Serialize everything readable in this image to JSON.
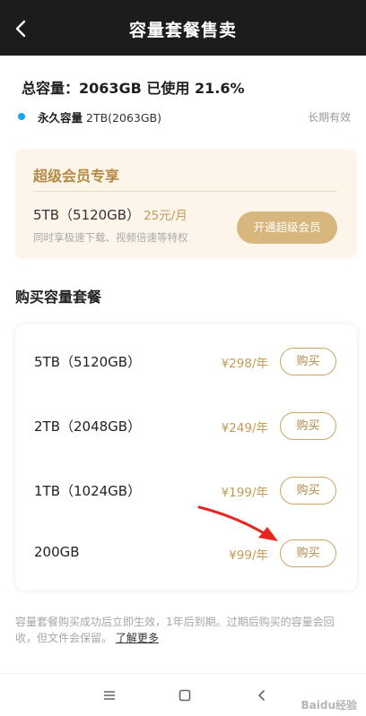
{
  "header": {
    "title": "容量套餐售卖"
  },
  "capacity": {
    "total_line": "总容量：2063GB  已使用 21.6%",
    "permanent_label": "永久容量",
    "permanent_detail": "2TB(2063GB)",
    "permanent_valid": "长期有效",
    "dot_color": "#1aa3f0"
  },
  "vip": {
    "title": "超级会员专享",
    "plan": "5TB（5120GB）",
    "price": "25元/月",
    "desc": "同时享极速下载、视频倍速等特权",
    "button": "开通超级会员"
  },
  "plans_section": {
    "title": "购买容量套餐"
  },
  "plans": [
    {
      "name": "5TB（5120GB）",
      "price": "¥298/年",
      "button": "购买"
    },
    {
      "name": "2TB（2048GB）",
      "price": "¥249/年",
      "button": "购买"
    },
    {
      "name": "1TB（1024GB）",
      "price": "¥199/年",
      "button": "购买"
    },
    {
      "name": "200GB",
      "price": "¥99/年",
      "button": "购买"
    }
  ],
  "footnote": {
    "text": "容量套餐购买成功后立即生效，1年后到期。过期后购买的容量会回收，但文件会保留。",
    "link": "了解更多"
  },
  "navbar": {
    "icons": [
      "menu-icon",
      "home-square-icon",
      "back-chevron-icon"
    ]
  },
  "watermark": "Baidu经验",
  "colors": {
    "accent_gold": "#c59a55",
    "header_bg": "#1c1c1c",
    "annotation_arrow": "#e8261f"
  }
}
